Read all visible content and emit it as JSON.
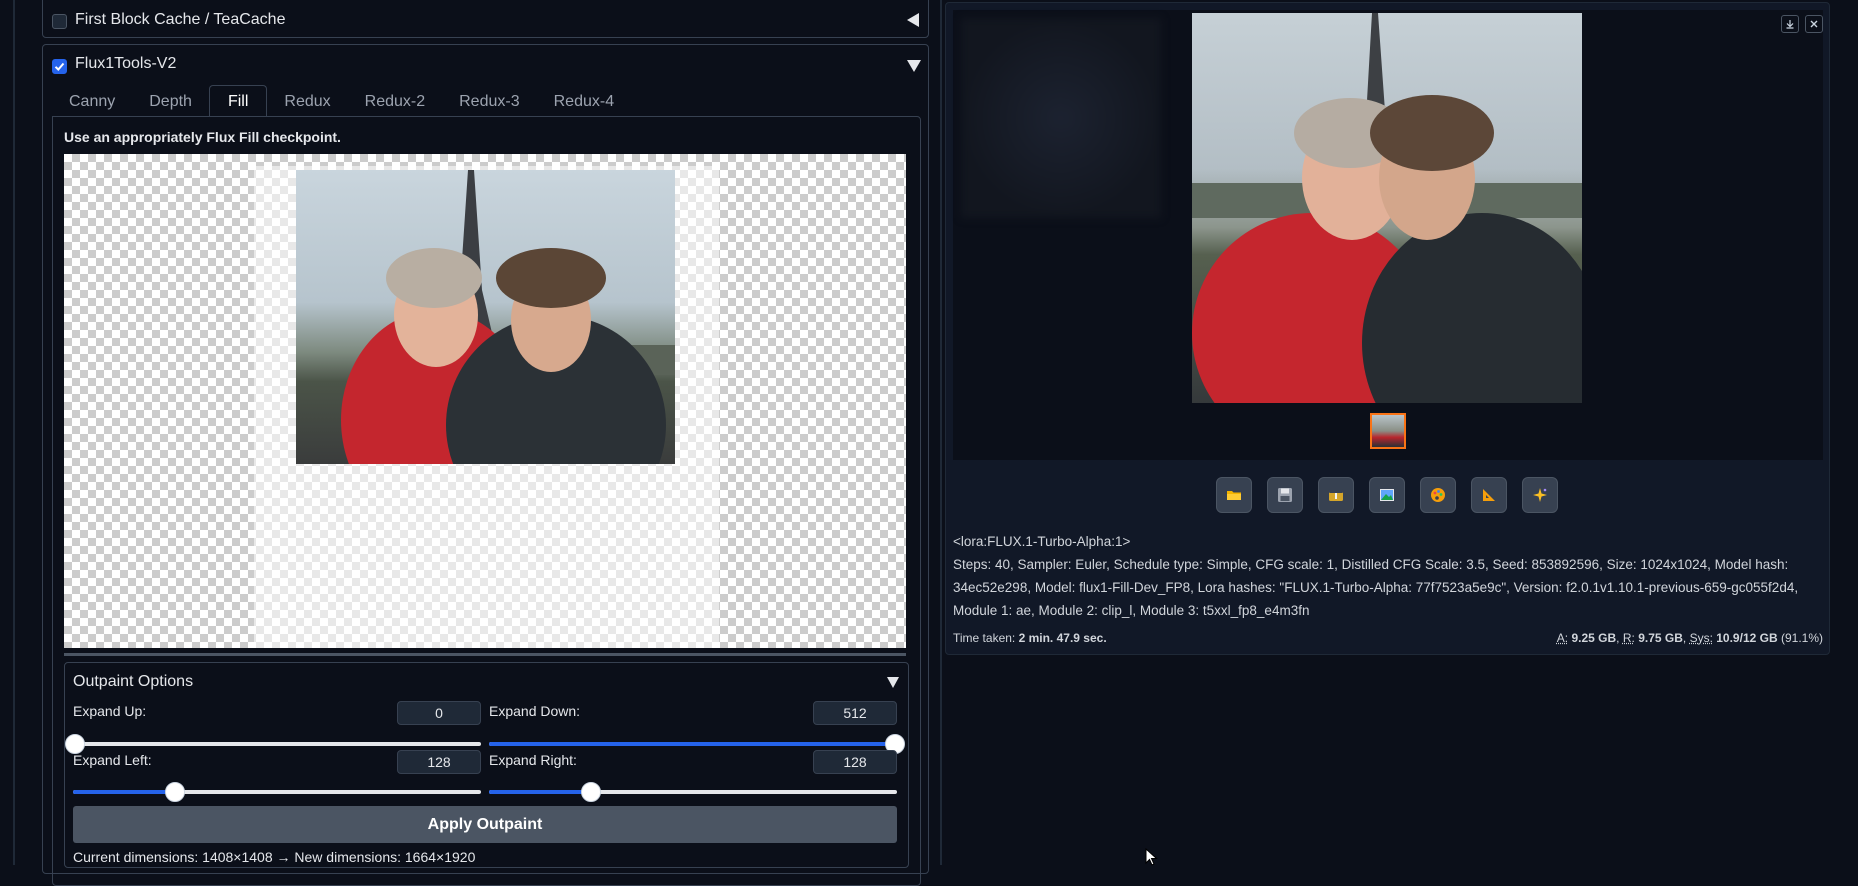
{
  "accordions": {
    "first_block": {
      "title": "First Block Cache / TeaCache",
      "checked": false
    },
    "flux_tools": {
      "title": "Flux1Tools-V2",
      "checked": true
    }
  },
  "tabs": [
    "Canny",
    "Depth",
    "Fill",
    "Redux",
    "Redux-2",
    "Redux-3",
    "Redux-4"
  ],
  "selected_tab": "Fill",
  "fill": {
    "hint": "Use an appropriately Flux Fill checkpoint."
  },
  "outpaint": {
    "title": "Outpaint Options",
    "expand_up": {
      "label": "Expand Up:",
      "value": "0",
      "fraction": 0.0
    },
    "expand_down": {
      "label": "Expand Down:",
      "value": "512",
      "fraction": 1.0
    },
    "expand_left": {
      "label": "Expand Left:",
      "value": "128",
      "fraction": 0.25
    },
    "expand_right": {
      "label": "Expand Right:",
      "value": "128",
      "fraction": 0.25
    },
    "apply_label": "Apply Outpaint",
    "dimensions_text": "Current dimensions: 1408×1408 → New dimensions: 1664×1920"
  },
  "output": {
    "toolbar": [
      "folder-icon",
      "save-icon",
      "zip-icon",
      "image-icon",
      "palette-icon",
      "ruler-icon",
      "sparkle-icon"
    ],
    "prompt": "<lora:FLUX.1-Turbo-Alpha:1>",
    "params": "Steps: 40, Sampler: Euler, Schedule type: Simple, CFG scale: 1, Distilled CFG Scale: 3.5, Seed: 853892596, Size: 1024x1024, Model hash: 34ec52e298, Model: flux1-Fill-Dev_FP8, Lora hashes: \"FLUX.1-Turbo-Alpha: 77f7523a5e9c\", Version: f2.0.1v1.10.1-previous-659-gc055f2d4, Module 1: ae, Module 2: clip_l, Module 3: t5xxl_fp8_e4m3fn",
    "time_label": "Time taken:",
    "time_value": "2 min. 47.9 sec.",
    "mem_a_label": "A:",
    "mem_a": "9.25 GB",
    "mem_r_label": "R:",
    "mem_r": "9.75 GB",
    "mem_sys_label": "Sys:",
    "mem_sys": "10.9/12 GB",
    "mem_pct": "(91.1%)"
  },
  "colors": {
    "accent": "#2563eb",
    "background": "#0b0f19",
    "panel": "#111827"
  }
}
